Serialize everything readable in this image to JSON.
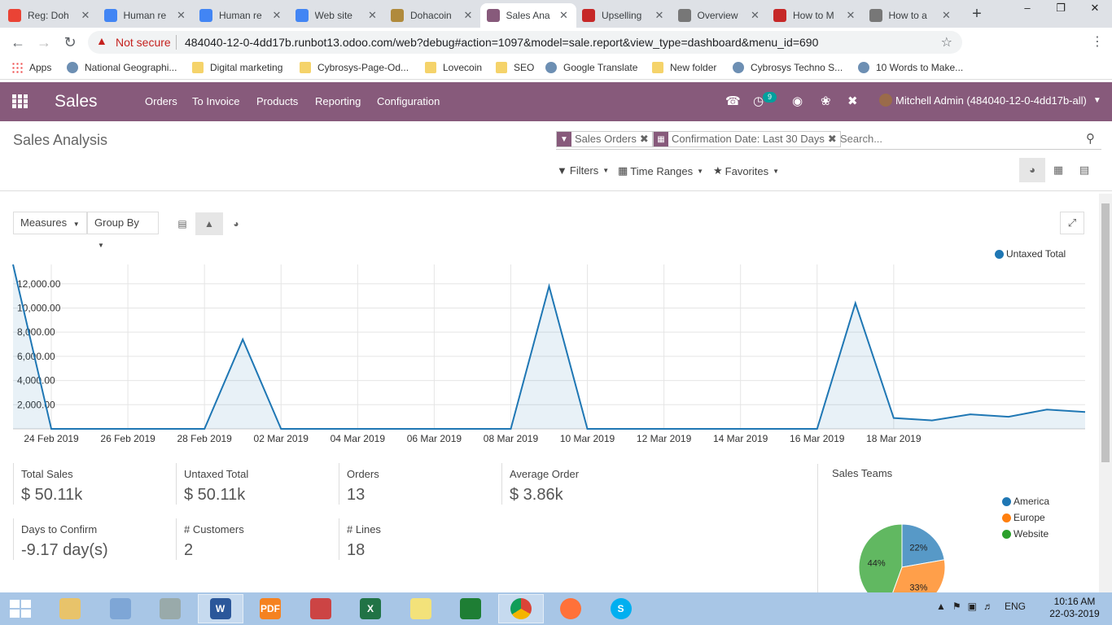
{
  "browser": {
    "tabs": [
      {
        "title": "Reg: Doh",
        "icon": "gmail-icon",
        "color": "#ea4335"
      },
      {
        "title": "Human re",
        "icon": "docs-icon",
        "color": "#4285f4"
      },
      {
        "title": "Human re",
        "icon": "docs-icon",
        "color": "#4285f4"
      },
      {
        "title": "Web site",
        "icon": "docs-icon",
        "color": "#4285f4"
      },
      {
        "title": "Dohacoin",
        "icon": "dohacoin-icon",
        "color": "#b08a3c"
      },
      {
        "title": "Sales Ana",
        "icon": "odoo-icon",
        "color": "#875a7b"
      },
      {
        "title": "Upselling",
        "icon": "cybrosys-icon",
        "color": "#c62828"
      },
      {
        "title": "Overview",
        "icon": "globe-icon",
        "color": "#777777"
      },
      {
        "title": "How to M",
        "icon": "cybrosys-icon",
        "color": "#c62828"
      },
      {
        "title": "How to a",
        "icon": "globe-icon",
        "color": "#777777"
      }
    ],
    "active_tab": 5,
    "not_secure": "Not secure",
    "url": "484040-12-0-4dd17b.runbot13.odoo.com/web?debug#action=1097&model=sale.report&view_type=dashboard&menu_id=690",
    "bookmarks": [
      {
        "label": "Apps",
        "icon": "apps-grid-icon"
      },
      {
        "label": "National Geographi...",
        "icon": "natgeo-icon"
      },
      {
        "label": "Digital marketing",
        "icon": "folder-icon"
      },
      {
        "label": "Cybrosys-Page-Od...",
        "icon": "folder-icon"
      },
      {
        "label": "Lovecoin",
        "icon": "folder-icon"
      },
      {
        "label": "SEO",
        "icon": "folder-icon"
      },
      {
        "label": "Google Translate",
        "icon": "translate-icon"
      },
      {
        "label": "New folder",
        "icon": "folder-icon"
      },
      {
        "label": "Cybrosys Techno S...",
        "icon": "globe-icon"
      },
      {
        "label": "10 Words to Make...",
        "icon": "yd-icon"
      }
    ]
  },
  "odoo": {
    "app_name": "Sales",
    "menus": [
      "Orders",
      "To Invoice",
      "Products",
      "Reporting",
      "Configuration"
    ],
    "activity_count": "9",
    "user": "Mitchell Admin (484040-12-0-4dd17b-all)",
    "brand_color": "#875a7b"
  },
  "control_panel": {
    "title": "Sales Analysis",
    "facets": [
      {
        "label": "Sales Orders",
        "icon": "filter-icon"
      },
      {
        "label": "Confirmation Date: Last 30 Days",
        "icon": "calendar-icon"
      }
    ],
    "search_placeholder": "Search...",
    "filters": "Filters",
    "time_ranges": "Time Ranges",
    "favorites": "Favorites"
  },
  "dashboard": {
    "measures": "Measures",
    "group_by": "Group By",
    "active_chart": "line"
  },
  "chart_data": {
    "type": "area",
    "series": [
      {
        "name": "Untaxed Total",
        "color": "#1f77b4",
        "values": [
          13600,
          0,
          0,
          0,
          0,
          0,
          7400,
          0,
          0,
          0,
          0,
          0,
          0,
          0,
          11800,
          0,
          0,
          0,
          0,
          0,
          0,
          0,
          10400,
          900,
          700,
          1200,
          1000,
          1600,
          1400
        ]
      }
    ],
    "x": [
      "23 Feb 2019",
      "24 Feb 2019",
      "25 Feb 2019",
      "26 Feb 2019",
      "27 Feb 2019",
      "28 Feb 2019",
      "01 Mar 2019",
      "02 Mar 2019",
      "03 Mar 2019",
      "04 Mar 2019",
      "05 Mar 2019",
      "06 Mar 2019",
      "07 Mar 2019",
      "08 Mar 2019",
      "09 Mar 2019",
      "10 Mar 2019",
      "11 Mar 2019",
      "12 Mar 2019",
      "13 Mar 2019",
      "14 Mar 2019",
      "15 Mar 2019",
      "16 Mar 2019",
      "17 Mar 2019",
      "18 Mar 2019",
      "19 Mar 2019",
      "20 Mar 2019",
      "21 Mar 2019",
      "22 Mar 2019",
      "23 Mar 2019"
    ],
    "xticks": [
      "24 Feb 2019",
      "26 Feb 2019",
      "28 Feb 2019",
      "02 Mar 2019",
      "04 Mar 2019",
      "06 Mar 2019",
      "08 Mar 2019",
      "10 Mar 2019",
      "12 Mar 2019",
      "14 Mar 2019",
      "16 Mar 2019",
      "18 Mar 2019"
    ],
    "yticks": [
      "2,000.00",
      "4,000.00",
      "6,000.00",
      "8,000.00",
      "10,000.00",
      "12,000.00"
    ],
    "ylim": [
      0,
      13600
    ],
    "legend": "top-right",
    "grid": true
  },
  "aggregates": [
    {
      "label": "Total Sales",
      "value": "$ 50.11k"
    },
    {
      "label": "Untaxed Total",
      "value": "$ 50.11k"
    },
    {
      "label": "Orders",
      "value": "13"
    },
    {
      "label": "Average Order",
      "value": "$ 3.86k"
    },
    {
      "label": "Days to Confirm",
      "value": "-9.17 day(s)"
    },
    {
      "label": "# Customers",
      "value": "2"
    },
    {
      "label": "# Lines",
      "value": "18"
    }
  ],
  "pie": {
    "title": "Sales Teams",
    "type": "pie",
    "slices": [
      {
        "name": "America",
        "value": 22,
        "label": "22%",
        "color": "#1f77b4"
      },
      {
        "name": "Europe",
        "value": 33,
        "label": "33%",
        "color": "#ff7f0e"
      },
      {
        "name": "Website",
        "value": 44,
        "label": "44%",
        "color": "#2ca02c"
      }
    ]
  },
  "taskbar": {
    "apps": [
      "Explorer",
      "Notes",
      "Media",
      "Word",
      "PDF",
      "Snipping",
      "Excel",
      "Sticky",
      "Calculator",
      "Chrome",
      "Firefox",
      "Skype"
    ],
    "lang": "ENG",
    "time": "10:16 AM",
    "date": "22-03-2019"
  }
}
